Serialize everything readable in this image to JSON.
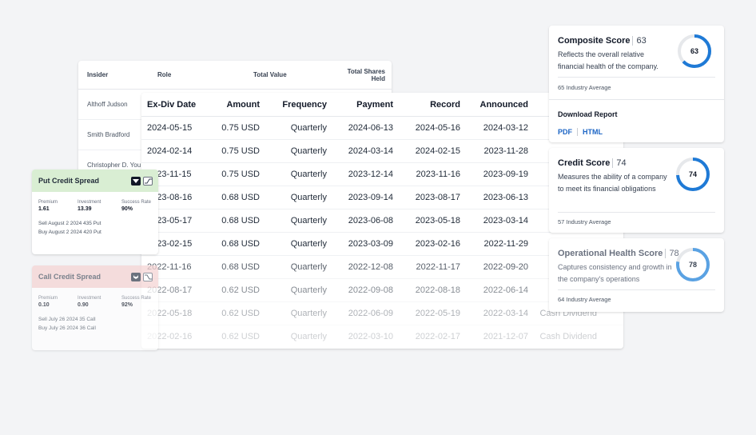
{
  "insider_table": {
    "headers": [
      "Insider",
      "Role",
      "Total Value",
      "Total Shares Held"
    ],
    "rows": [
      "Althoff Judson",
      "Smith Bradford",
      "Christopher D. You"
    ]
  },
  "dividend_table": {
    "headers": [
      "Ex-Div Date",
      "Amount",
      "Frequency",
      "Payment",
      "Record",
      "Announced"
    ],
    "rows": [
      {
        "ex": "2024-05-15",
        "amount": "0.75 USD",
        "freq": "Quarterly",
        "pay": "2024-06-13",
        "rec": "2024-05-16",
        "ann": "2024-03-12",
        "type": ""
      },
      {
        "ex": "2024-02-14",
        "amount": "0.75 USD",
        "freq": "Quarterly",
        "pay": "2024-03-14",
        "rec": "2024-02-15",
        "ann": "2023-11-28",
        "type": ""
      },
      {
        "ex": "2023-11-15",
        "amount": "0.75 USD",
        "freq": "Quarterly",
        "pay": "2023-12-14",
        "rec": "2023-11-16",
        "ann": "2023-09-19",
        "type": ""
      },
      {
        "ex": "2023-08-16",
        "amount": "0.68 USD",
        "freq": "Quarterly",
        "pay": "2023-09-14",
        "rec": "2023-08-17",
        "ann": "2023-06-13",
        "type": ""
      },
      {
        "ex": "2023-05-17",
        "amount": "0.68 USD",
        "freq": "Quarterly",
        "pay": "2023-06-08",
        "rec": "2023-05-18",
        "ann": "2023-03-14",
        "type": ""
      },
      {
        "ex": "2023-02-15",
        "amount": "0.68 USD",
        "freq": "Quarterly",
        "pay": "2023-03-09",
        "rec": "2023-02-16",
        "ann": "2022-11-29",
        "type": ""
      },
      {
        "ex": "2022-11-16",
        "amount": "0.68 USD",
        "freq": "Quarterly",
        "pay": "2022-12-08",
        "rec": "2022-11-17",
        "ann": "2022-09-20",
        "type": ""
      },
      {
        "ex": "2022-08-17",
        "amount": "0.62 USD",
        "freq": "Quarterly",
        "pay": "2022-09-08",
        "rec": "2022-08-18",
        "ann": "2022-06-14",
        "type": ""
      },
      {
        "ex": "2022-05-18",
        "amount": "0.62 USD",
        "freq": "Quarterly",
        "pay": "2022-06-09",
        "rec": "2022-05-19",
        "ann": "2022-03-14",
        "type": "Cash Dividend"
      },
      {
        "ex": "2022-02-16",
        "amount": "0.62 USD",
        "freq": "Quarterly",
        "pay": "2022-03-10",
        "rec": "2022-02-17",
        "ann": "2021-12-07",
        "type": "Cash Dividend"
      }
    ]
  },
  "put_spread": {
    "title": "Put Credit Spread",
    "premium_label": "Premium",
    "premium": "1.61",
    "investment_label": "Investment",
    "investment": "13.39",
    "success_label": "Success Rate",
    "success": "90%",
    "leg1": "Sell August 2 2024 435 Put",
    "leg2": "Buy August 2 2024 420 Put",
    "header_color": "#d9eed3"
  },
  "call_spread": {
    "title": "Call Credit Spread",
    "premium_label": "Premium",
    "premium": "0.10",
    "investment_label": "Investment",
    "investment": "0.90",
    "success_label": "Success Rate",
    "success": "92%",
    "leg1": "Sell July 26 2024 35 Call",
    "leg2": "Buy July 26 2024 36 Call",
    "header_color": "#f5d3d3"
  },
  "composite": {
    "title": "Composite Score",
    "score": "63",
    "desc": "Reflects the overall relative financial health of the company.",
    "avg": "65 Industry Average",
    "progress": 63,
    "download_title": "Download Report",
    "pdf": "PDF",
    "html": "HTML"
  },
  "credit": {
    "title": "Credit Score",
    "score": "74",
    "desc": "Measures the ability of a company to meet its financial obligations",
    "avg": "57 Industry Average",
    "progress": 74
  },
  "operational": {
    "title": "Operational Health Score",
    "score": "78",
    "desc": "Captures consistency and growth in the company's operations",
    "avg": "64 Industry Average",
    "progress": 78
  },
  "colors": {
    "ring_blue": "#1f7ad6",
    "ring_light_blue": "#5aa2e3",
    "ring_track": "#e6e8eb",
    "link_blue": "#1d66c5"
  }
}
